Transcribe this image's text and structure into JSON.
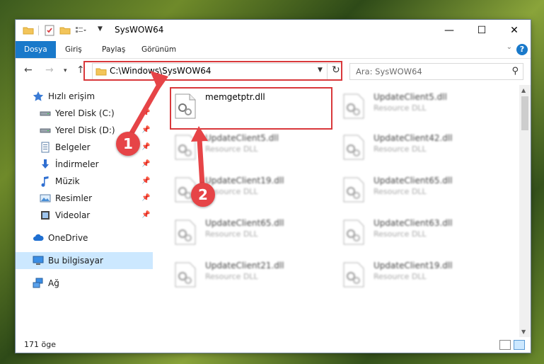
{
  "window": {
    "title": "SysWOW64",
    "controls": {
      "minimize": "—",
      "maximize": "☐",
      "close": "✕"
    }
  },
  "ribbon": {
    "tabs": [
      "Dosya",
      "Giriş",
      "Paylaş",
      "Görünüm"
    ],
    "help": "?"
  },
  "nav": {
    "address": "C:\\Windows\\SysWOW64",
    "search_placeholder": "Ara: SysWOW64"
  },
  "sidebar": {
    "items": [
      {
        "label": "Hızlı erişim"
      },
      {
        "label": "Yerel Disk (C:)"
      },
      {
        "label": "Yerel Disk (D:)"
      },
      {
        "label": "Belgeler"
      },
      {
        "label": "İndirmeler"
      },
      {
        "label": "Müzik"
      },
      {
        "label": "Resimler"
      },
      {
        "label": "Videolar"
      },
      {
        "label": "OneDrive"
      },
      {
        "label": "Bu bilgisayar"
      },
      {
        "label": "Ağ"
      }
    ]
  },
  "files": [
    {
      "name": "memgetptr.dll",
      "desc": ""
    },
    {
      "name": "UpdateClient5.dll",
      "desc": "Resource DLL"
    },
    {
      "name": "UpdateClient5.dll",
      "desc": "Resource DLL"
    },
    {
      "name": "UpdateClient42.dll",
      "desc": "Resource DLL"
    },
    {
      "name": "UpdateClient19.dll",
      "desc": "Resource DLL"
    },
    {
      "name": "UpdateClient65.dll",
      "desc": "Resource DLL"
    },
    {
      "name": "UpdateClient65.dll",
      "desc": "Resource DLL"
    },
    {
      "name": "UpdateClient63.dll",
      "desc": "Resource DLL"
    },
    {
      "name": "UpdateClient21.dll",
      "desc": "Resource DLL"
    },
    {
      "name": "UpdateClient19.dll",
      "desc": "Resource DLL"
    }
  ],
  "status": {
    "count": "171 öge"
  },
  "callouts": {
    "one": "1",
    "two": "2"
  },
  "colors": {
    "accent": "#1979ca",
    "highlight": "#d9383b",
    "selection": "#cce8ff"
  }
}
